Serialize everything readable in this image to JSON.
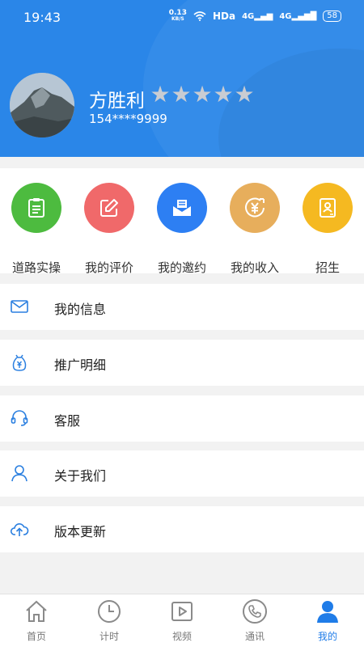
{
  "status_bar": {
    "time": "19:43",
    "net_speed": "0.13",
    "net_unit": "KB/S",
    "hd": "HDa",
    "sig1": "4G",
    "sig2": "4G",
    "battery": "58"
  },
  "profile": {
    "name": "方胜利",
    "phone": "154****9999",
    "rating": 5,
    "rating_max": 5
  },
  "shortcuts": [
    {
      "label": "道路实操",
      "icon": "clipboard-icon",
      "color": "#4dbb3f"
    },
    {
      "label": "我的评价",
      "icon": "edit-icon",
      "color": "#f0696a"
    },
    {
      "label": "我的邀约",
      "icon": "envelope-open-icon",
      "color": "#2d7ff3"
    },
    {
      "label": "我的收入",
      "icon": "yuan-income-icon",
      "color": "#e7ae5c"
    },
    {
      "label": "招生",
      "icon": "id-card-icon",
      "color": "#f5b921"
    }
  ],
  "menu": [
    {
      "label": "我的信息",
      "icon": "mail-icon"
    },
    {
      "label": "推广明细",
      "icon": "yuan-bag-icon"
    },
    {
      "label": "客服",
      "icon": "headset-icon"
    },
    {
      "label": "关于我们",
      "icon": "user-icon"
    },
    {
      "label": "版本更新",
      "icon": "cloud-upload-icon"
    }
  ],
  "tabs": [
    {
      "label": "首页",
      "icon": "home-icon"
    },
    {
      "label": "计时",
      "icon": "clock-icon"
    },
    {
      "label": "视频",
      "icon": "video-icon"
    },
    {
      "label": "通讯",
      "icon": "phone-icon"
    },
    {
      "label": "我的",
      "icon": "person-icon",
      "active": true
    }
  ],
  "colors": {
    "header": "#2a86e8",
    "accent": "#1f7ce8",
    "menu_icon": "#2a7fe0"
  }
}
